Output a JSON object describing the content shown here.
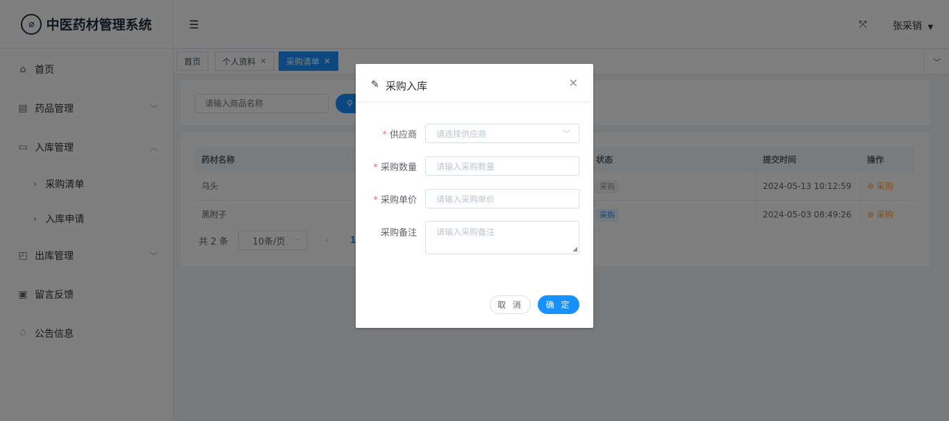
{
  "app": {
    "title": "中医药材管理系统",
    "logo_icon": "leaf-icon"
  },
  "sidebar": {
    "items": [
      {
        "label": "首页",
        "icon": "home-icon"
      },
      {
        "label": "药品管理",
        "icon": "document-icon",
        "expanded": false
      },
      {
        "label": "入库管理",
        "icon": "inbox-icon",
        "expanded": true
      },
      {
        "label": "出库管理",
        "icon": "export-icon",
        "expanded": false
      },
      {
        "label": "留言反馈",
        "icon": "chat-icon"
      },
      {
        "label": "公告信息",
        "icon": "bell-icon"
      }
    ],
    "sub_items": [
      {
        "label": "采购清单"
      },
      {
        "label": "入库申请"
      }
    ]
  },
  "header": {
    "user_name": "张采销"
  },
  "tabs": [
    {
      "label": "首页",
      "closable": false,
      "active": false
    },
    {
      "label": "个人资料",
      "closable": true,
      "active": false
    },
    {
      "label": "采购清单",
      "closable": true,
      "active": true
    }
  ],
  "search": {
    "placeholder": "请输入商品名称"
  },
  "table": {
    "columns": [
      "药材名称",
      "状态",
      "提交时间",
      "操作"
    ],
    "rows": [
      {
        "name": "乌头",
        "status": "采购",
        "time": "2024-05-13 10:12:59",
        "action": "采购"
      },
      {
        "name": "黑附子",
        "status": "采购",
        "time": "2024-05-03 08:49:26",
        "action": "采购"
      }
    ]
  },
  "pagination": {
    "total_text": "共 2 条",
    "page_size": "10条/页",
    "current_page": "1"
  },
  "dialog": {
    "title": "采购入库",
    "fields": [
      {
        "label": "供应商",
        "required": true,
        "placeholder": "请选择供应商"
      },
      {
        "label": "采购数量",
        "required": true,
        "placeholder": "请输入采购数量"
      },
      {
        "label": "采购单价",
        "required": true,
        "placeholder": "请输入采购单价"
      },
      {
        "label": "采购备注",
        "required": false,
        "placeholder": "请输入采购备注"
      }
    ],
    "cancel_label": "取 消",
    "confirm_label": "确 定"
  },
  "colors": {
    "primary": "#1890ff",
    "required": "#f56c6c",
    "action": "#ff9a3c"
  }
}
